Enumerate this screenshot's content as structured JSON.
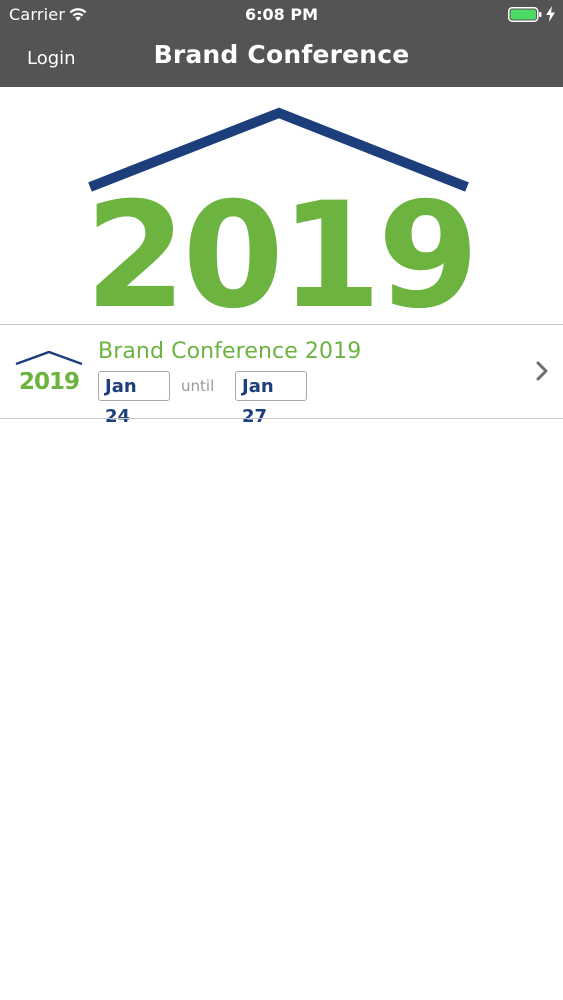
{
  "status_bar": {
    "carrier": "Carrier",
    "time": "6:08 PM",
    "wifi_icon": "wifi-icon",
    "battery_icon": "battery-full-icon",
    "charging_icon": "charging-bolt-icon"
  },
  "nav": {
    "login_label": "Login",
    "title": "Brand Conference"
  },
  "banner": {
    "logo_year": "2019",
    "roof_color": "#1c3f7c",
    "year_color": "#6cb33f"
  },
  "events": [
    {
      "title": "Brand Conference 2019",
      "logo_year": "2019",
      "start_date": "Jan 24",
      "until_label": "until",
      "end_date": "Jan 27",
      "chevron_icon": "chevron-right-icon"
    }
  ],
  "colors": {
    "header_bg": "#545454",
    "accent_green": "#6cb33f",
    "accent_navy": "#1c3f7c",
    "battery_green": "#4cd964"
  }
}
